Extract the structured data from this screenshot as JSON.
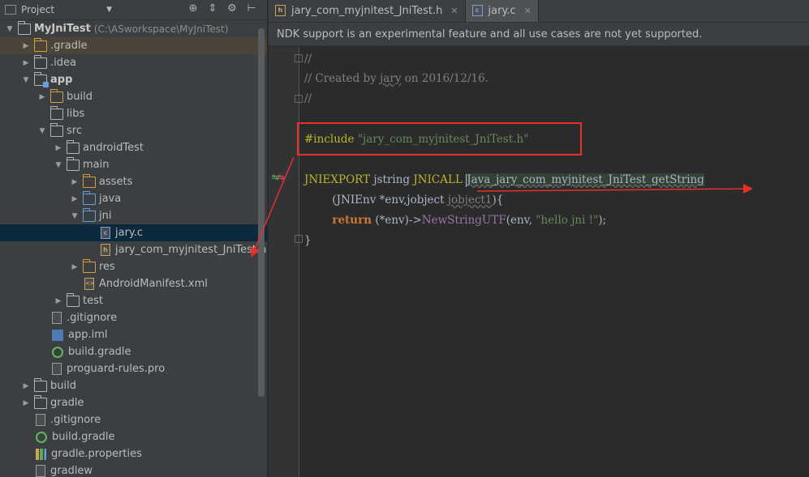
{
  "project_panel": {
    "title": "Project",
    "tree": [
      {
        "label": "MyJniTest",
        "path": "(C:\\ASworkspace\\MyJniTest)",
        "level": 0,
        "arrow": "down",
        "icon": "folder",
        "bold": true
      },
      {
        "label": ".gradle",
        "level": 1,
        "arrow": "right",
        "icon": "folder-orange",
        "highlighted": true
      },
      {
        "label": ".idea",
        "level": 1,
        "arrow": "right",
        "icon": "folder"
      },
      {
        "label": "app",
        "level": 1,
        "arrow": "down",
        "icon": "folder-module",
        "bold": true
      },
      {
        "label": "build",
        "level": 2,
        "arrow": "right",
        "icon": "folder-orange"
      },
      {
        "label": "libs",
        "level": 2,
        "arrow": "none",
        "icon": "folder"
      },
      {
        "label": "src",
        "level": 2,
        "arrow": "down",
        "icon": "folder"
      },
      {
        "label": "androidTest",
        "level": 3,
        "arrow": "right",
        "icon": "folder"
      },
      {
        "label": "main",
        "level": 3,
        "arrow": "down",
        "icon": "folder"
      },
      {
        "label": "assets",
        "level": 4,
        "arrow": "right",
        "icon": "folder-res"
      },
      {
        "label": "java",
        "level": 4,
        "arrow": "right",
        "icon": "folder-blue"
      },
      {
        "label": "jni",
        "level": 4,
        "arrow": "down",
        "icon": "folder-blue"
      },
      {
        "label": "jary.c",
        "level": 5,
        "arrow": "none",
        "icon": "file-c",
        "selected": true
      },
      {
        "label": "jary_com_myjnitest_JniTest.h",
        "level": 5,
        "arrow": "none",
        "icon": "file-h"
      },
      {
        "label": "res",
        "level": 4,
        "arrow": "right",
        "icon": "folder-res"
      },
      {
        "label": "AndroidManifest.xml",
        "level": 4,
        "arrow": "none",
        "icon": "file-xml"
      },
      {
        "label": "test",
        "level": 3,
        "arrow": "right",
        "icon": "folder"
      },
      {
        "label": ".gitignore",
        "level": 2,
        "arrow": "none",
        "icon": "file"
      },
      {
        "label": "app.iml",
        "level": 2,
        "arrow": "none",
        "icon": "iml"
      },
      {
        "label": "build.gradle",
        "level": 2,
        "arrow": "none",
        "icon": "gradle"
      },
      {
        "label": "proguard-rules.pro",
        "level": 2,
        "arrow": "none",
        "icon": "file"
      },
      {
        "label": "build",
        "level": 1,
        "arrow": "right",
        "icon": "folder"
      },
      {
        "label": "gradle",
        "level": 1,
        "arrow": "right",
        "icon": "folder"
      },
      {
        "label": ".gitignore",
        "level": 1,
        "arrow": "none",
        "icon": "file"
      },
      {
        "label": "build.gradle",
        "level": 1,
        "arrow": "none",
        "icon": "gradle"
      },
      {
        "label": "gradle.properties",
        "level": 1,
        "arrow": "none",
        "icon": "props"
      },
      {
        "label": "gradlew",
        "level": 1,
        "arrow": "none",
        "icon": "file"
      }
    ]
  },
  "editor": {
    "tabs": [
      {
        "label": "jary_com_myjnitest_JniTest.h",
        "icon": "h",
        "active": false
      },
      {
        "label": "jary.c",
        "icon": "c",
        "active": true
      }
    ],
    "notice": "NDK support is an experimental feature and all use cases are not yet supported.",
    "code": {
      "l1": "//",
      "l2_a": "// Created by ",
      "l2_b": "jary",
      "l2_c": " on 2016/12/16.",
      "l3": "//",
      "include_kw": "#include",
      "include_str": " \"jary_com_myjnitest_JniTest.h\"",
      "jniexport": "JNIEXPORT",
      "jstring": " jstring ",
      "jnicall": "JNICALL",
      "fname": "Java_jary_com_myjnitest_JniTest_getString",
      "p_open": "(JNIEnv *env,",
      "p_jobject": "jobject ",
      "p_jobject1": "jobject1",
      "p_close": "){",
      "ret_kw": "return",
      "ret_a": " (*env)->",
      "ret_fn": "NewStringUTF",
      "ret_b": "(env, ",
      "ret_str": "\"hello jni !\"",
      "ret_c": ");",
      "brace": "}"
    }
  }
}
